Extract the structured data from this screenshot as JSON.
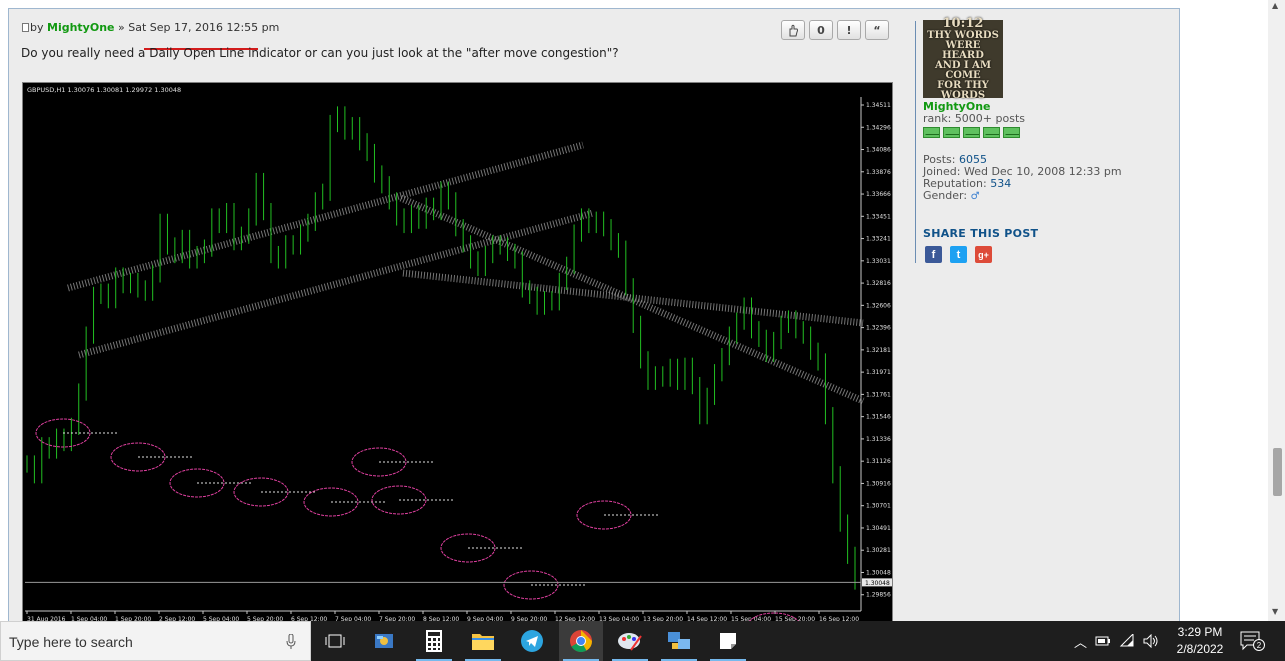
{
  "post": {
    "by_prefix": "by",
    "author": "MightyOne",
    "date_sep": "»",
    "date": "Sat Sep 17, 2016 12:55 pm",
    "text": "Do you really need a Daily Open Line indicator or can you just look at the \"after move congestion\"?",
    "buttons": [
      "",
      "0",
      "!",
      "“"
    ]
  },
  "chart_data": {
    "type": "line",
    "title": "GBPUSD,H1  1.30076 1.30081 1.29972 1.30048",
    "y_ticks": [
      "1.34511",
      "1.34296",
      "1.34086",
      "1.33876",
      "1.33666",
      "1.33451",
      "1.33241",
      "1.33031",
      "1.32816",
      "1.32606",
      "1.32396",
      "1.32181",
      "1.31971",
      "1.31761",
      "1.31546",
      "1.31336",
      "1.31126",
      "1.30916",
      "1.30701",
      "1.30491",
      "1.30281",
      "1.30048",
      "1.29856"
    ],
    "x_ticks": [
      "31 Aug 2016",
      "1 Sep 04:00",
      "1 Sep 20:00",
      "2 Sep 12:00",
      "5 Sep 04:00",
      "5 Sep 20:00",
      "6 Sep 12:00",
      "7 Sep 04:00",
      "7 Sep 20:00",
      "8 Sep 12:00",
      "9 Sep 04:00",
      "9 Sep 20:00",
      "12 Sep 12:00",
      "13 Sep 04:00",
      "13 Sep 20:00",
      "14 Sep 12:00",
      "15 Sep 04:00",
      "15 Sep 20:00",
      "16 Sep 12:00"
    ],
    "current_price": "1.30048",
    "ylim": [
      1.29856,
      1.34511
    ],
    "series": [
      {
        "values": [
          1.3115,
          1.3105,
          1.3132,
          1.3128,
          1.314,
          1.3135,
          1.315,
          1.3182,
          1.3235,
          1.3272,
          1.3275,
          1.3268,
          1.329,
          1.3282,
          1.3285,
          1.3278,
          1.3275,
          1.3292,
          1.334,
          1.3318,
          1.331,
          1.3325,
          1.3305,
          1.331,
          1.3316,
          1.3345,
          1.3338,
          1.335,
          1.3322,
          1.3328,
          1.3345,
          1.3378,
          1.335,
          1.331,
          1.3305,
          1.332,
          1.3318,
          1.333,
          1.334,
          1.336,
          1.3368,
          1.3432,
          1.344,
          1.3425,
          1.343,
          1.3415,
          1.3405,
          1.3385,
          1.3375,
          1.336,
          1.3345,
          1.3338,
          1.3348,
          1.3342,
          1.3355,
          1.335,
          1.337,
          1.336,
          1.3335,
          1.332,
          1.3305,
          1.3298,
          1.331,
          1.332,
          1.3318,
          1.3312,
          1.3305,
          1.3278,
          1.3272,
          1.3262,
          1.3268,
          1.3266,
          1.3285,
          1.33,
          1.333,
          1.3345,
          1.3338,
          1.3342,
          1.3335,
          1.3322,
          1.3315,
          1.328,
          1.3245,
          1.3212,
          1.3192,
          1.3198,
          1.3195,
          1.3205,
          1.3192,
          1.3206,
          1.3188,
          1.316,
          1.3178,
          1.32,
          1.3215,
          1.3235,
          1.3248,
          1.3262,
          1.324,
          1.3232,
          1.3218,
          1.323,
          1.3245,
          1.325,
          1.324,
          1.3235,
          1.322,
          1.321,
          1.316,
          1.3105,
          1.306,
          1.303,
          1.3006
        ]
      }
    ]
  },
  "profile": {
    "avatar_lines": [
      "10:12",
      "THY WORDS",
      "WERE HEARD",
      "AND I AM COME",
      "FOR THY WORDS"
    ],
    "username": "MightyOne",
    "rank_label": "rank:",
    "rank_value": "5000+ posts",
    "posts_label": "Posts:",
    "posts_value": "6055",
    "joined_label": "Joined:",
    "joined_value": "Wed Dec 10, 2008 12:33 pm",
    "reputation_label": "Reputation:",
    "reputation_value": "534",
    "gender_label": "Gender:",
    "share_title": "SHARE THIS POST",
    "share_icons": [
      "facebook-icon",
      "twitter-icon",
      "google-plus-icon"
    ]
  },
  "taskbar": {
    "search_placeholder": "Type here to search",
    "apps": [
      "task-view-icon",
      "control-panel-icon",
      "calculator-icon",
      "file-explorer-icon",
      "telegram-icon",
      "chrome-icon",
      "paint-icon",
      "network-app-icon",
      "sticky-notes-icon"
    ],
    "time": "3:29 PM",
    "date": "2/8/2022",
    "notifications": "2"
  },
  "colors": {
    "author_green": "#119911",
    "link_blue": "#105289",
    "chart_bg": "#000000",
    "candle_green": "#22c022",
    "underline_red": "#d21c1c"
  }
}
